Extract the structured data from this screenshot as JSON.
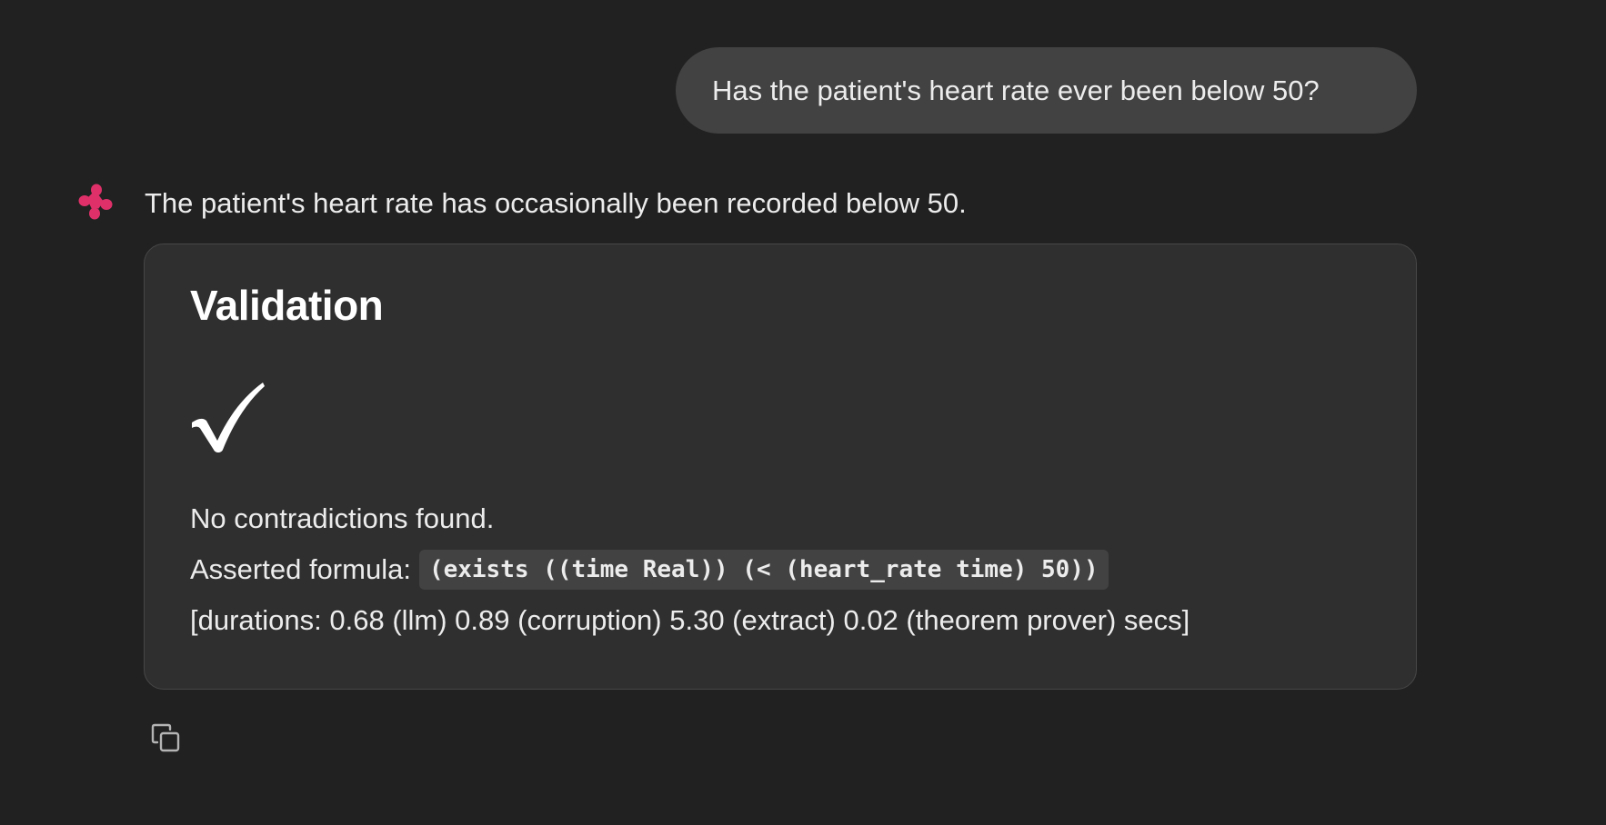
{
  "user_message": {
    "text": "Has the patient's heart rate ever been below 50?"
  },
  "assistant": {
    "avatar_icon": "assistant-logo-icon",
    "accent_color": "#e0306a",
    "reply": "The patient's heart rate has occasionally been recorded below 50.",
    "validation": {
      "title": "Validation",
      "result_icon": "check-mark-icon",
      "result_glyph": "✓",
      "status": "No contradictions found.",
      "formula_label": "Asserted formula:",
      "formula": "(exists ((time Real)) (< (heart_rate time) 50))",
      "durations": "[durations: 0.68 (llm) 0.89 (corruption) 5.30 (extract) 0.02 (theorem prover) secs]"
    },
    "actions": {
      "copy_icon": "copy-icon"
    }
  }
}
